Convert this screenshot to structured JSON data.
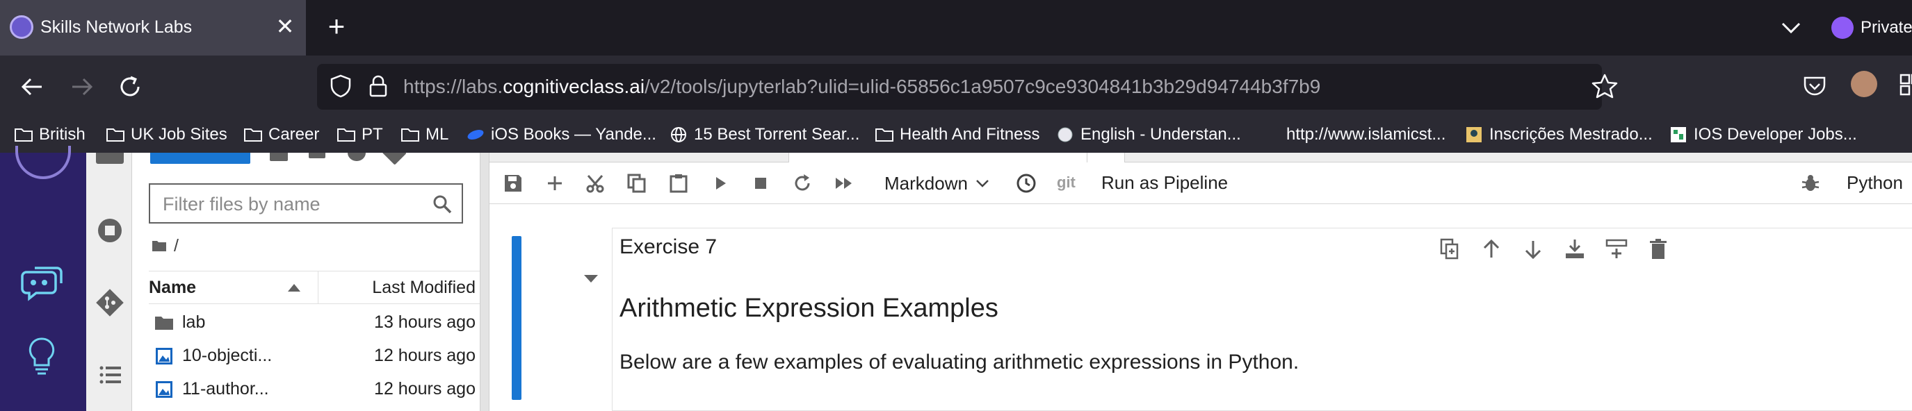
{
  "browser": {
    "tab": {
      "title": "Skills Network Labs",
      "close": "✕"
    },
    "new_tab": "+",
    "private_label": "Private",
    "url": {
      "prefix": "https://labs.",
      "domain": "cognitiveclass.ai",
      "path": "/v2/tools/jupyterlab?ulid=ulid-65856c1a9507c9ce9304841b3b29d94744b3f7b9"
    },
    "bookmarks": [
      {
        "label": "British",
        "icon": "folder-icon"
      },
      {
        "label": "UK Job Sites",
        "icon": "folder-icon"
      },
      {
        "label": "Career",
        "icon": "folder-icon"
      },
      {
        "label": "PT",
        "icon": "folder-icon"
      },
      {
        "label": "ML",
        "icon": "folder-icon"
      },
      {
        "label": "iOS Books — Yande...",
        "icon": "yandex-icon"
      },
      {
        "label": "15 Best Torrent Sear...",
        "icon": "globe-icon"
      },
      {
        "label": "Health And Fitness",
        "icon": "folder-icon"
      },
      {
        "label": "English - Understan...",
        "icon": "site-icon"
      },
      {
        "label": "http://www.islamicst...",
        "icon": "none"
      },
      {
        "label": "Inscrições Mestrado...",
        "icon": "site-icon"
      },
      {
        "label": "IOS Developer Jobs...",
        "icon": "site-icon"
      }
    ]
  },
  "filebrowser": {
    "filter_placeholder": "Filter files by name",
    "breadcrumb": "/",
    "columns": {
      "name": "Name",
      "modified": "Last Modified"
    },
    "rows": [
      {
        "name": "lab",
        "modified": "13 hours ago",
        "type": "folder"
      },
      {
        "name": "10-objecti...",
        "modified": "12 hours ago",
        "type": "image"
      },
      {
        "name": "11-author...",
        "modified": "12 hours ago",
        "type": "image"
      }
    ]
  },
  "notebook": {
    "toolbar": {
      "cell_type": "Markdown",
      "git": "git",
      "run_pipeline": "Run as Pipeline",
      "kernel": "Python"
    },
    "cell": {
      "heading_small": "Exercise 7",
      "heading": "Arithmetic Expression Examples",
      "paragraph": "Below are a few examples of evaluating arithmetic expressions in Python."
    }
  },
  "colors": {
    "brand_sidebar": "#2c2167",
    "accent_blue": "#1976d2",
    "chrome_dark": "#1c1b22",
    "chrome_mid": "#2b2a33"
  }
}
